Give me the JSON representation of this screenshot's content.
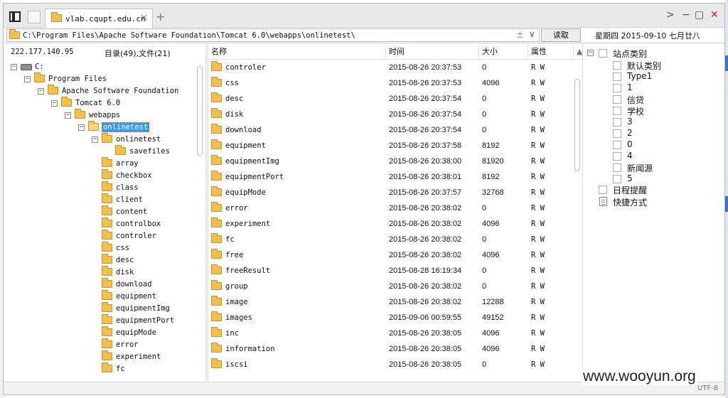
{
  "tab": {
    "title": "vlab.cqupt.edu.cn"
  },
  "address": {
    "path": "C:\\Program Files\\Apache Software Foundation\\Tomcat 6.0\\webapps\\onlinetest\\",
    "read_label": "读取"
  },
  "date_text": "星期四 2015-09-10 七月廿八",
  "left_header": {
    "ip": "222.177.140.95",
    "count": "目录(49),文件(21)"
  },
  "tree": [
    {
      "label": "C:",
      "depth": 0,
      "type": "drive",
      "exp": "−"
    },
    {
      "label": "Program Files",
      "depth": 1,
      "type": "folder",
      "exp": "−"
    },
    {
      "label": "Apache Software Foundation",
      "depth": 2,
      "type": "folder",
      "exp": "−"
    },
    {
      "label": "Tomcat 6.0",
      "depth": 3,
      "type": "folder",
      "exp": "−"
    },
    {
      "label": "webapps",
      "depth": 4,
      "type": "folder",
      "exp": "−"
    },
    {
      "label": "onlinetest",
      "depth": 5,
      "type": "folder-open",
      "exp": "−",
      "selected": true
    },
    {
      "label": "onlinetest",
      "depth": 6,
      "type": "folder",
      "exp": "−"
    },
    {
      "label": "savefiles",
      "depth": 7,
      "type": "folder",
      "exp": ""
    },
    {
      "label": "array",
      "depth": 6,
      "type": "folder",
      "exp": ""
    },
    {
      "label": "checkbox",
      "depth": 6,
      "type": "folder",
      "exp": ""
    },
    {
      "label": "class",
      "depth": 6,
      "type": "folder",
      "exp": ""
    },
    {
      "label": "client",
      "depth": 6,
      "type": "folder",
      "exp": ""
    },
    {
      "label": "content",
      "depth": 6,
      "type": "folder",
      "exp": ""
    },
    {
      "label": "controlbox",
      "depth": 6,
      "type": "folder",
      "exp": ""
    },
    {
      "label": "controler",
      "depth": 6,
      "type": "folder",
      "exp": ""
    },
    {
      "label": "css",
      "depth": 6,
      "type": "folder",
      "exp": ""
    },
    {
      "label": "desc",
      "depth": 6,
      "type": "folder",
      "exp": ""
    },
    {
      "label": "disk",
      "depth": 6,
      "type": "folder",
      "exp": ""
    },
    {
      "label": "download",
      "depth": 6,
      "type": "folder",
      "exp": ""
    },
    {
      "label": "equipment",
      "depth": 6,
      "type": "folder",
      "exp": ""
    },
    {
      "label": "equipmentImg",
      "depth": 6,
      "type": "folder",
      "exp": ""
    },
    {
      "label": "equipmentPort",
      "depth": 6,
      "type": "folder",
      "exp": ""
    },
    {
      "label": "equipMode",
      "depth": 6,
      "type": "folder",
      "exp": ""
    },
    {
      "label": "error",
      "depth": 6,
      "type": "folder",
      "exp": ""
    },
    {
      "label": "experiment",
      "depth": 6,
      "type": "folder",
      "exp": ""
    },
    {
      "label": "fc",
      "depth": 6,
      "type": "folder",
      "exp": ""
    }
  ],
  "columns": [
    "名称",
    "时间",
    "大小",
    "属性"
  ],
  "files": [
    {
      "name": "controler",
      "time": "2015-08-26 20:37:53",
      "size": "0",
      "attr": "R W"
    },
    {
      "name": "css",
      "time": "2015-08-26 20:37:53",
      "size": "4096",
      "attr": "R W"
    },
    {
      "name": "desc",
      "time": "2015-08-26 20:37:54",
      "size": "0",
      "attr": "R W"
    },
    {
      "name": "disk",
      "time": "2015-08-26 20:37:54",
      "size": "0",
      "attr": "R W"
    },
    {
      "name": "download",
      "time": "2015-08-26 20:37:54",
      "size": "0",
      "attr": "R W"
    },
    {
      "name": "equipment",
      "time": "2015-08-26 20:37:58",
      "size": "8192",
      "attr": "R W"
    },
    {
      "name": "equipmentImg",
      "time": "2015-08-26 20:38:00",
      "size": "81920",
      "attr": "R W"
    },
    {
      "name": "equipmentPort",
      "time": "2015-08-26 20:38:01",
      "size": "8192",
      "attr": "R W"
    },
    {
      "name": "equipMode",
      "time": "2015-08-26 20:37:57",
      "size": "32768",
      "attr": "R W"
    },
    {
      "name": "error",
      "time": "2015-08-26 20:38:02",
      "size": "0",
      "attr": "R W"
    },
    {
      "name": "experiment",
      "time": "2015-08-26 20:38:02",
      "size": "4096",
      "attr": "R W"
    },
    {
      "name": "fc",
      "time": "2015-08-26 20:38:02",
      "size": "0",
      "attr": "R W"
    },
    {
      "name": "free",
      "time": "2015-08-26 20:38:02",
      "size": "4096",
      "attr": "R W"
    },
    {
      "name": "freeResult",
      "time": "2015-08-28 16:19:34",
      "size": "0",
      "attr": "R W"
    },
    {
      "name": "group",
      "time": "2015-08-26 20:38:02",
      "size": "0",
      "attr": "R W"
    },
    {
      "name": "image",
      "time": "2015-08-26 20:38:02",
      "size": "12288",
      "attr": "R W"
    },
    {
      "name": "images",
      "time": "2015-09-06 00:59:55",
      "size": "49152",
      "attr": "R W"
    },
    {
      "name": "inc",
      "time": "2015-08-26 20:38:05",
      "size": "4096",
      "attr": "R W"
    },
    {
      "name": "information",
      "time": "2015-08-26 20:38:05",
      "size": "4096",
      "attr": "R W"
    },
    {
      "name": "iscsi",
      "time": "2015-08-26 20:38:05",
      "size": "0",
      "attr": "R W"
    }
  ],
  "right_tree": {
    "site_root": "站点类别",
    "site_items": [
      "默认类别",
      "Type1",
      "1",
      "信贷",
      "学校",
      "3",
      "2",
      "0",
      "4",
      "新闻源",
      "5"
    ],
    "schedule": "日程提醒",
    "shortcuts": "快捷方式"
  },
  "status": {
    "encoding": "UTF-8"
  },
  "watermark": "www.wooyun.org"
}
